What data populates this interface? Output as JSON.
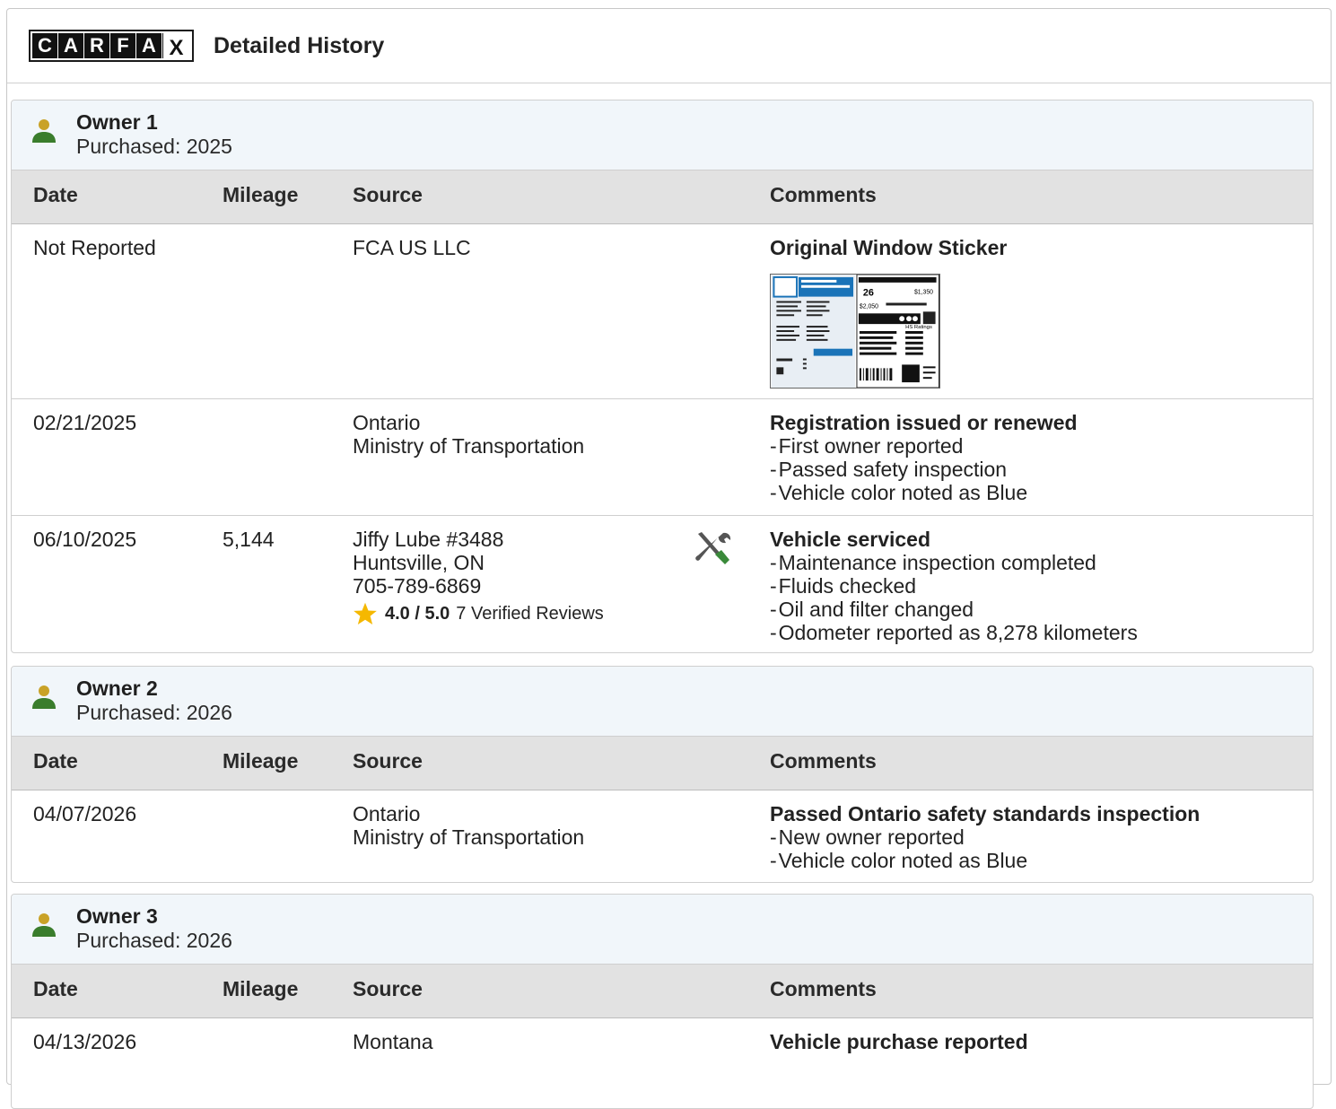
{
  "header": {
    "logo_letters": [
      "C",
      "A",
      "R",
      "F",
      "A",
      "X"
    ],
    "title": "Detailed History"
  },
  "table_headers": {
    "date": "Date",
    "mileage": "Mileage",
    "source": "Source",
    "comments": "Comments"
  },
  "owners": [
    {
      "name": "Owner 1",
      "purchased": "Purchased: 2025",
      "rows": [
        {
          "date": "Not Reported",
          "mileage": "",
          "source": [
            "FCA US LLC"
          ],
          "comment_title": "Original Window Sticker",
          "comment_lines": [],
          "sticker_values": {
            "mpg": "26",
            "save": "$1,350",
            "cost": "$2,050",
            "ratings": "HS Ratings"
          }
        },
        {
          "date": "02/21/2025",
          "mileage": "",
          "source": [
            "Ontario",
            "Ministry of Transportation"
          ],
          "comment_title": "Registration issued or renewed",
          "comment_lines": [
            "First owner reported",
            "Passed safety inspection",
            "Vehicle color noted as Blue"
          ]
        },
        {
          "date": "06/10/2025",
          "mileage": "5,144",
          "source": [
            "Jiffy Lube #3488",
            "Huntsville, ON",
            "705-789-6869"
          ],
          "review": {
            "score": "4.0 / 5.0",
            "count": "7 Verified Reviews"
          },
          "comment_title": "Vehicle serviced",
          "comment_lines": [
            "Maintenance inspection completed",
            "Fluids checked",
            "Oil and filter changed",
            "Odometer reported as 8,278 kilometers"
          ]
        }
      ]
    },
    {
      "name": "Owner 2",
      "purchased": "Purchased: 2026",
      "rows": [
        {
          "date": "04/07/2026",
          "mileage": "",
          "source": [
            "Ontario",
            "Ministry of Transportation"
          ],
          "comment_title": "Passed Ontario safety standards inspection",
          "comment_lines": [
            "New owner reported",
            "Vehicle color noted as Blue"
          ]
        }
      ]
    },
    {
      "name": "Owner 3",
      "purchased": "Purchased: 2026",
      "rows": [
        {
          "date": "04/13/2026",
          "mileage": "",
          "source": [
            "Montana"
          ],
          "comment_title": "Vehicle purchase reported",
          "comment_lines": []
        }
      ]
    }
  ],
  "colors": {
    "owner_head_bg": "#f1f6fa",
    "table_head_bg": "#e2e2e2",
    "owner_icon_head": "#c9a227",
    "owner_icon_body": "#3a7d2c",
    "star": "#f5b800"
  }
}
